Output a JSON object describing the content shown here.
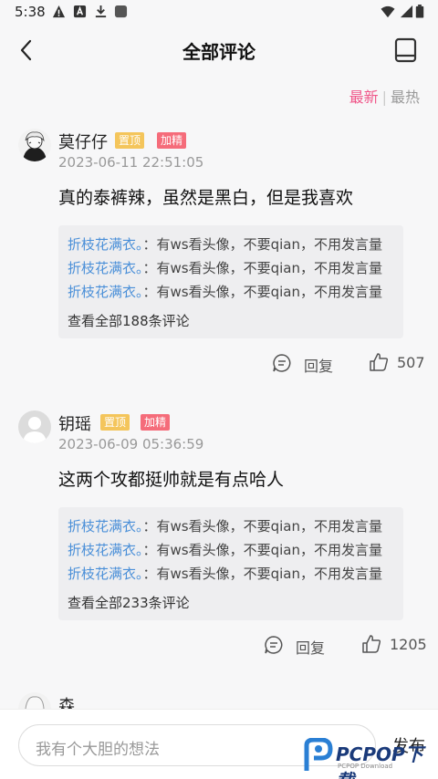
{
  "status_bar": {
    "time": "5:38"
  },
  "header": {
    "title": "全部评论"
  },
  "sort": {
    "latest": "最新",
    "sep": "|",
    "hottest": "最热"
  },
  "comments": [
    {
      "username": "莫仔仔",
      "tag_top": "置顶",
      "tag_jing": "加精",
      "time": "2023-06-11 22:51:05",
      "body": "真的泰裤辣，虽然是黑白，但是我喜欢",
      "replies": [
        {
          "name": "折枝花满衣。",
          "text": "：有ws看头像，不要qian，不用发言量"
        },
        {
          "name": "折枝花满衣。",
          "text": "：有ws看头像，不要qian，不用发言量"
        },
        {
          "name": "折枝花满衣。",
          "text": "：有ws看头像，不要qian，不用发言量"
        }
      ],
      "view_all": "查看全部188条评论",
      "reply_label": "回复",
      "likes": "507"
    },
    {
      "username": "钥瑶",
      "tag_top": "置顶",
      "tag_jing": "加精",
      "time": "2023-06-09 05:36:59",
      "body": "这两个攻都挺帅就是有点哈人",
      "replies": [
        {
          "name": "折枝花满衣。",
          "text": "：有ws看头像，不要qian，不用发言量"
        },
        {
          "name": "折枝花满衣。",
          "text": "：有ws看头像，不要qian，不用发言量"
        },
        {
          "name": "折枝花满衣。",
          "text": "：有ws看头像，不要qian，不用发言量"
        }
      ],
      "view_all": "查看全部233条评论",
      "reply_label": "回复",
      "likes": "1205"
    },
    {
      "username": "森"
    }
  ],
  "bottom": {
    "placeholder": "我有个大胆的想法",
    "send": "发布"
  },
  "watermark": {
    "brand": "PCPOP下载",
    "sub": "PCPOP Download"
  },
  "colors": {
    "accent": "#f0578a",
    "link": "#4a8fd8",
    "tag_top": "#f4c55b",
    "tag_jing": "#f56c7a"
  }
}
